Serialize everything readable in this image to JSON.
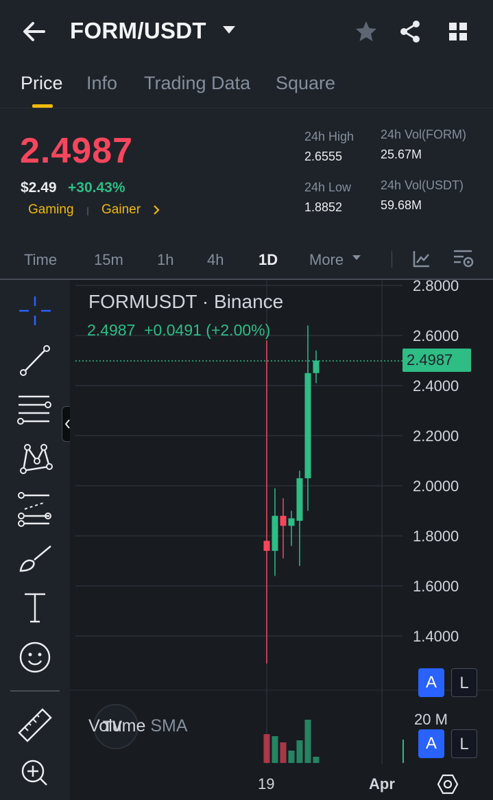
{
  "header": {
    "pair": "FORM/USDT",
    "icons": [
      "back-arrow-icon",
      "chevron-down-icon",
      "star-icon",
      "share-icon",
      "grid-icon"
    ]
  },
  "tabs": [
    {
      "label": "Price",
      "active": true
    },
    {
      "label": "Info"
    },
    {
      "label": "Trading Data"
    },
    {
      "label": "Square"
    }
  ],
  "ticker": {
    "last_price": "2.4987",
    "usd_price": "$2.49",
    "change_pct": "+30.43%",
    "tags": [
      "Gaming",
      "Gainer"
    ],
    "stats": {
      "high_label": "24h High",
      "high_value": "2.6555",
      "low_label": "24h Low",
      "low_value": "1.8852",
      "vol_base_label": "24h Vol(FORM)",
      "vol_base_value": "25.67M",
      "vol_quote_label": "24h Vol(USDT)",
      "vol_quote_value": "59.68M"
    },
    "colors": {
      "down": "#f6465d",
      "up": "#2ebd85",
      "accent": "#f0b90b"
    }
  },
  "intervals": {
    "items": [
      "Time",
      "15m",
      "1h",
      "4h",
      "1D",
      "More"
    ],
    "active": "1D",
    "icons": [
      "indicator-icon",
      "chart-settings-icon"
    ]
  },
  "toolbar": {
    "tools": [
      "crosshair-icon",
      "trend-line-icon",
      "horizontal-lines-icon",
      "pattern-icon",
      "fib-icon",
      "brush-icon",
      "text-icon",
      "emoji-icon",
      "ruler-icon",
      "zoom-in-icon"
    ]
  },
  "chart": {
    "title": "FORMUSDT · Binance",
    "ohlc_line": "2.4987  +0.0491 (+2.00%)",
    "last_price_tag": "2.4987",
    "price_axis": [
      "2.8000",
      "2.6000",
      "2.4000",
      "2.2000",
      "2.0000",
      "1.8000",
      "1.6000",
      "1.4000"
    ],
    "x_labels": [
      "19",
      "Apr"
    ],
    "volume_label": "Volume",
    "volume_sma": "SMA",
    "volume_axis": "20 M",
    "scale_buttons": [
      "A",
      "L"
    ],
    "tv_logo": "TV"
  },
  "chart_data": {
    "type": "candlestick",
    "title": "FORMUSDT · Binance",
    "ylim": [
      1.3,
      2.8
    ],
    "candles": [
      {
        "open": 1.78,
        "high": 2.58,
        "low": 1.29,
        "close": 1.74
      },
      {
        "open": 1.74,
        "high": 1.99,
        "low": 1.64,
        "close": 1.88
      },
      {
        "open": 1.88,
        "high": 1.95,
        "low": 1.71,
        "close": 1.84
      },
      {
        "open": 1.84,
        "high": 1.9,
        "low": 1.76,
        "close": 1.87
      },
      {
        "open": 1.86,
        "high": 2.06,
        "low": 1.68,
        "close": 2.03
      },
      {
        "open": 2.03,
        "high": 2.64,
        "low": 1.9,
        "close": 2.45
      },
      {
        "open": 2.45,
        "high": 2.54,
        "low": 2.41,
        "close": 2.5
      }
    ],
    "volume": [
      14,
      13,
      10,
      6,
      11,
      21,
      3
    ],
    "volume_colors": [
      "down",
      "up",
      "down",
      "up",
      "up",
      "up",
      "up"
    ]
  }
}
